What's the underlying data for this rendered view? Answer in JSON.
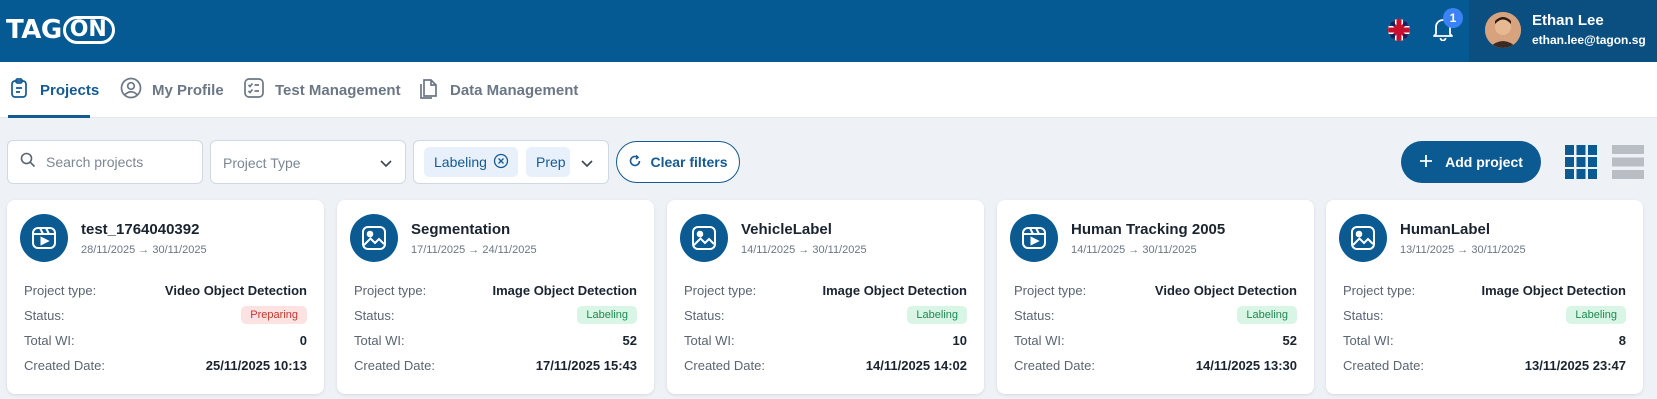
{
  "header": {
    "logo_text": "TAG",
    "logo_pill": "ON",
    "notification_count": "1",
    "user_name": "Ethan Lee",
    "user_email": "ethan.lee@tagon.sg",
    "brand_color": "#065a94"
  },
  "tabs": [
    {
      "label": "Projects",
      "icon": "clipboard-icon",
      "active": true
    },
    {
      "label": "My Profile",
      "icon": "user-circle-icon",
      "active": false
    },
    {
      "label": "Test Management",
      "icon": "checklist-icon",
      "active": false
    },
    {
      "label": "Data Management",
      "icon": "data-icon",
      "active": false
    }
  ],
  "filters": {
    "search_placeholder": "Search projects",
    "project_type_placeholder": "Project Type",
    "status_chips": [
      "Labeling",
      "Prep"
    ],
    "clear_label": "Clear filters",
    "add_label": "Add project"
  },
  "labels": {
    "project_type": "Project type:",
    "status": "Status:",
    "total_wi": "Total WI:",
    "created_date": "Created Date:"
  },
  "projects": [
    {
      "title": "test_1764040392",
      "dates": "28/11/2025 → 30/11/2025",
      "type": "Video Object Detection",
      "status": "Preparing",
      "total_wi": "0",
      "created": "25/11/2025 10:13",
      "icon": "video-icon"
    },
    {
      "title": "Segmentation",
      "dates": "17/11/2025 → 24/11/2025",
      "type": "Image Object Detection",
      "status": "Labeling",
      "total_wi": "52",
      "created": "17/11/2025 15:43",
      "icon": "image-icon"
    },
    {
      "title": "VehicleLabel",
      "dates": "14/11/2025 → 30/11/2025",
      "type": "Image Object Detection",
      "status": "Labeling",
      "total_wi": "10",
      "created": "14/11/2025 14:02",
      "icon": "image-icon"
    },
    {
      "title": "Human Tracking 2005",
      "dates": "14/11/2025 → 30/11/2025",
      "type": "Video Object Detection",
      "status": "Labeling",
      "total_wi": "52",
      "created": "14/11/2025 13:30",
      "icon": "video-icon"
    },
    {
      "title": "HumanLabel",
      "dates": "13/11/2025 → 30/11/2025",
      "type": "Image Object Detection",
      "status": "Labeling",
      "total_wi": "8",
      "created": "13/11/2025 23:47",
      "icon": "image-icon"
    }
  ]
}
